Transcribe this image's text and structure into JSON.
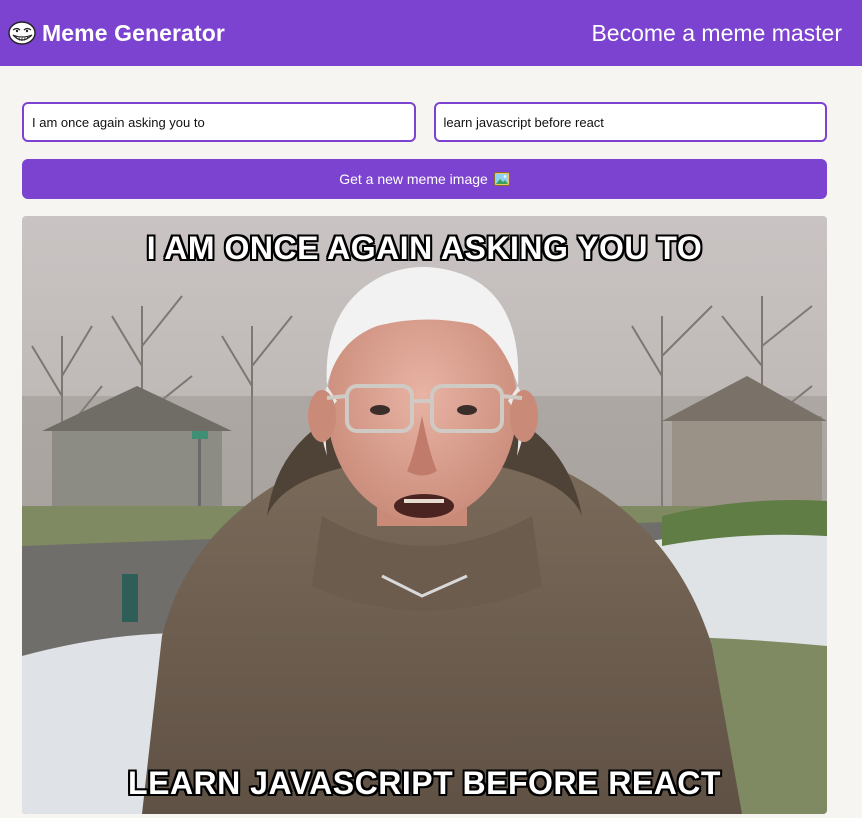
{
  "header": {
    "title": "Meme Generator",
    "tagline": "Become a meme master",
    "logo_icon": "troll-face-icon",
    "background_color": "#7b43d0"
  },
  "form": {
    "top_text_value": "I am once again asking you to",
    "bottom_text_value": "learn javascript before react",
    "button_label": "Get a new meme image",
    "button_icon": "framed-picture-icon"
  },
  "meme": {
    "top_caption": "I am once again asking you to",
    "bottom_caption": "learn javascript before react",
    "image_subject": "bernie-sanders-meme-image"
  }
}
